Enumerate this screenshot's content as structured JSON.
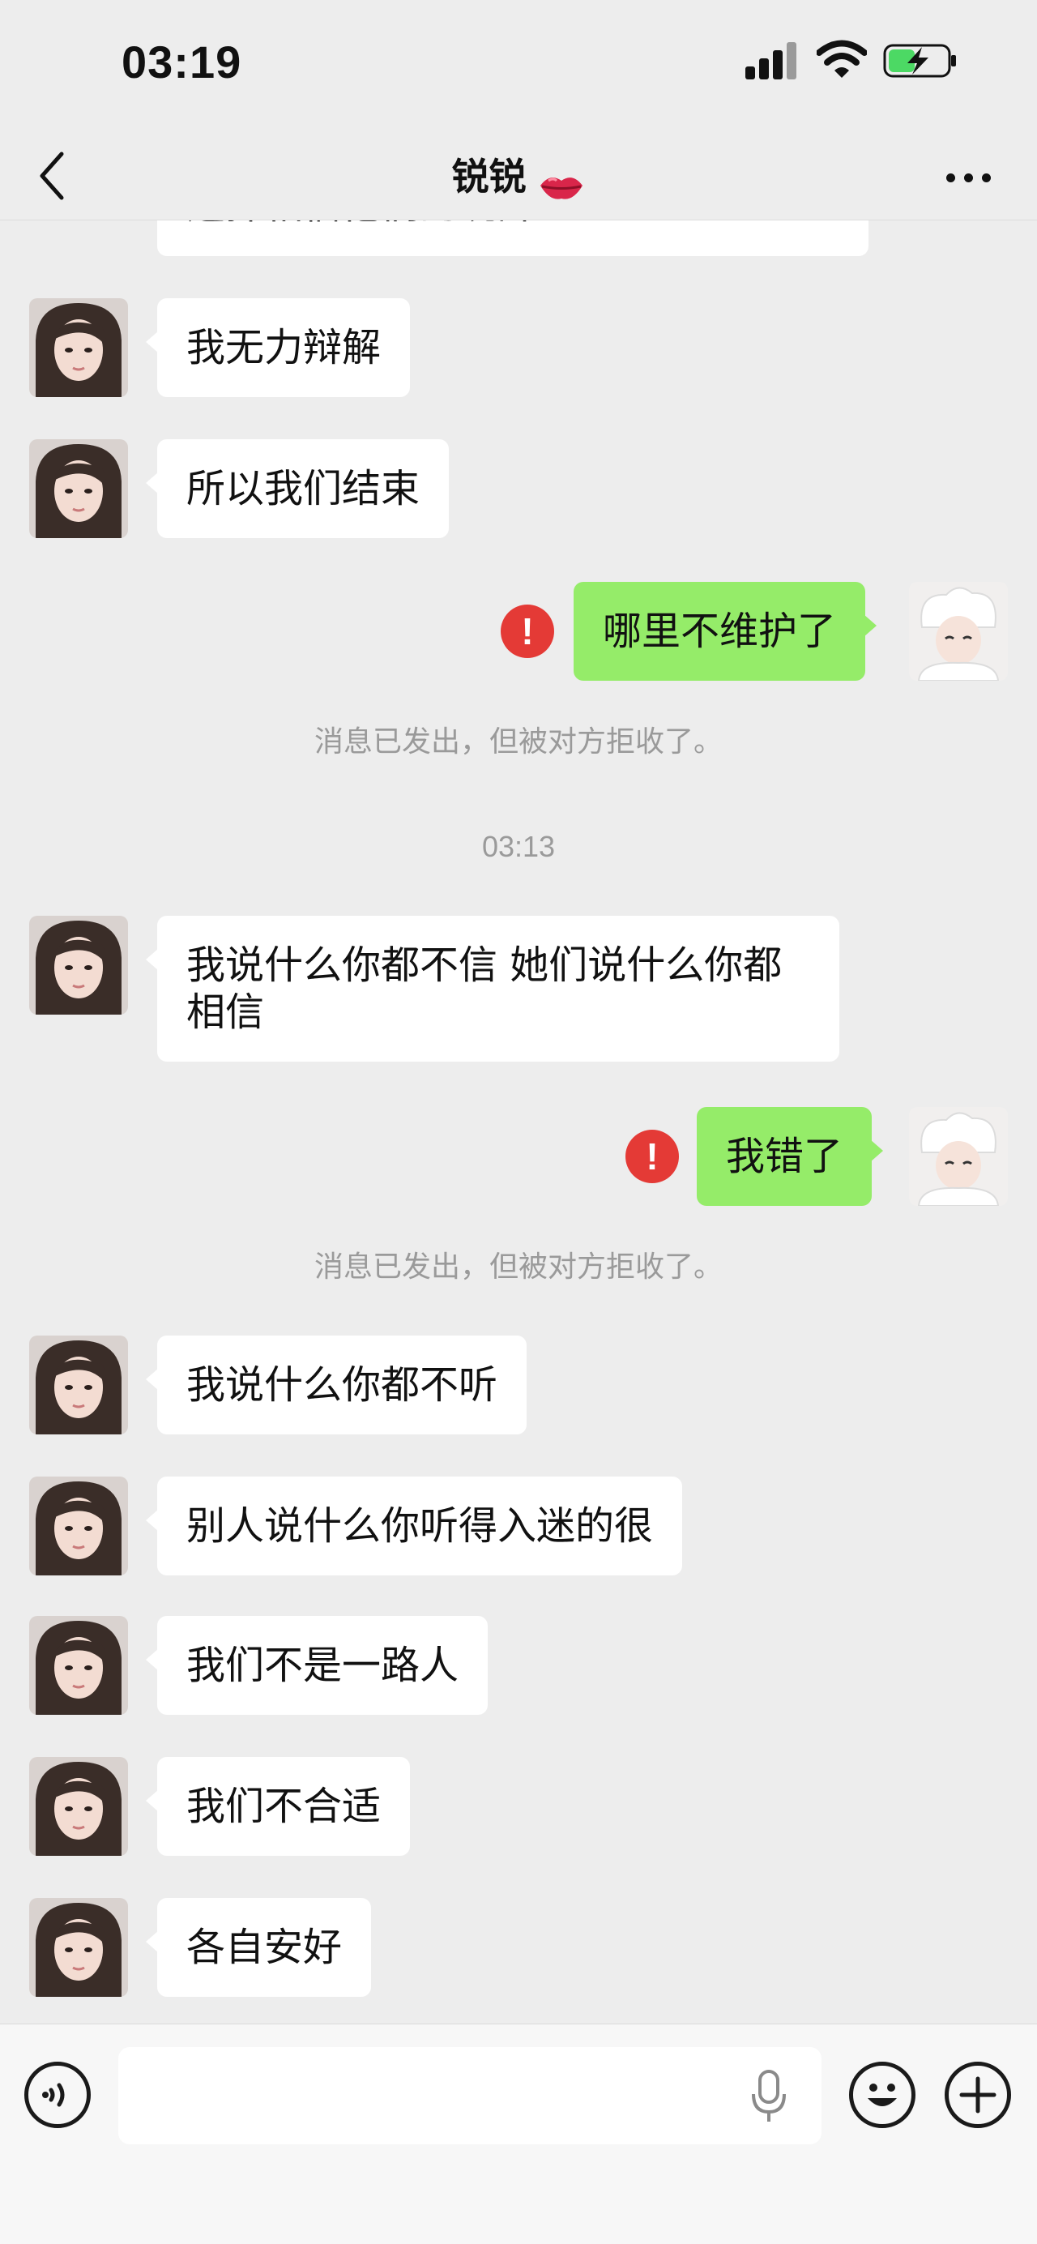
{
  "status_bar": {
    "time": "03:19",
    "icons": [
      "signal-icon",
      "wifi-icon",
      "battery-charging-icon"
    ]
  },
  "header": {
    "title": "锐锐",
    "title_emoji": "kiss-lips-emoji",
    "back_icon": "chevron-left-icon",
    "more_icon": "more-dots-icon"
  },
  "messages": [
    {
      "from": "her",
      "text": "选择相信他们的说辞"
    },
    {
      "from": "her",
      "text": "我无力辩解"
    },
    {
      "from": "her",
      "text": "所以我们结束"
    },
    {
      "from": "me",
      "text": "哪里不维护了",
      "status": "rejected"
    },
    {
      "system": "消息已发出，但被对方拒收了。"
    },
    {
      "timestamp": "03:13"
    },
    {
      "from": "her",
      "text_line1": "我说什么你都不信 她们说什么你都",
      "text_line2": "相信"
    },
    {
      "from": "me",
      "text": "我错了",
      "status": "rejected"
    },
    {
      "system": "消息已发出，但被对方拒收了。"
    },
    {
      "from": "her",
      "text": "我说什么你都不听"
    },
    {
      "from": "her",
      "text": "别人说什么你听得入迷的很"
    },
    {
      "from": "her",
      "text": "我们不是一路人"
    },
    {
      "from": "her",
      "text": "我们不合适"
    },
    {
      "from": "her",
      "text": "各自安好"
    }
  ],
  "warning_glyph": "!",
  "colors": {
    "background": "#ededed",
    "my_bubble": "#95ec69",
    "her_bubble": "#ffffff",
    "warning": "#e43a36",
    "system_text": "#9a9a9a"
  },
  "input_bar": {
    "voice_icon": "voice-toggle-icon",
    "mic_icon": "microphone-icon",
    "emoji_icon": "smiley-icon",
    "plus_icon": "plus-icon",
    "input_value": ""
  }
}
